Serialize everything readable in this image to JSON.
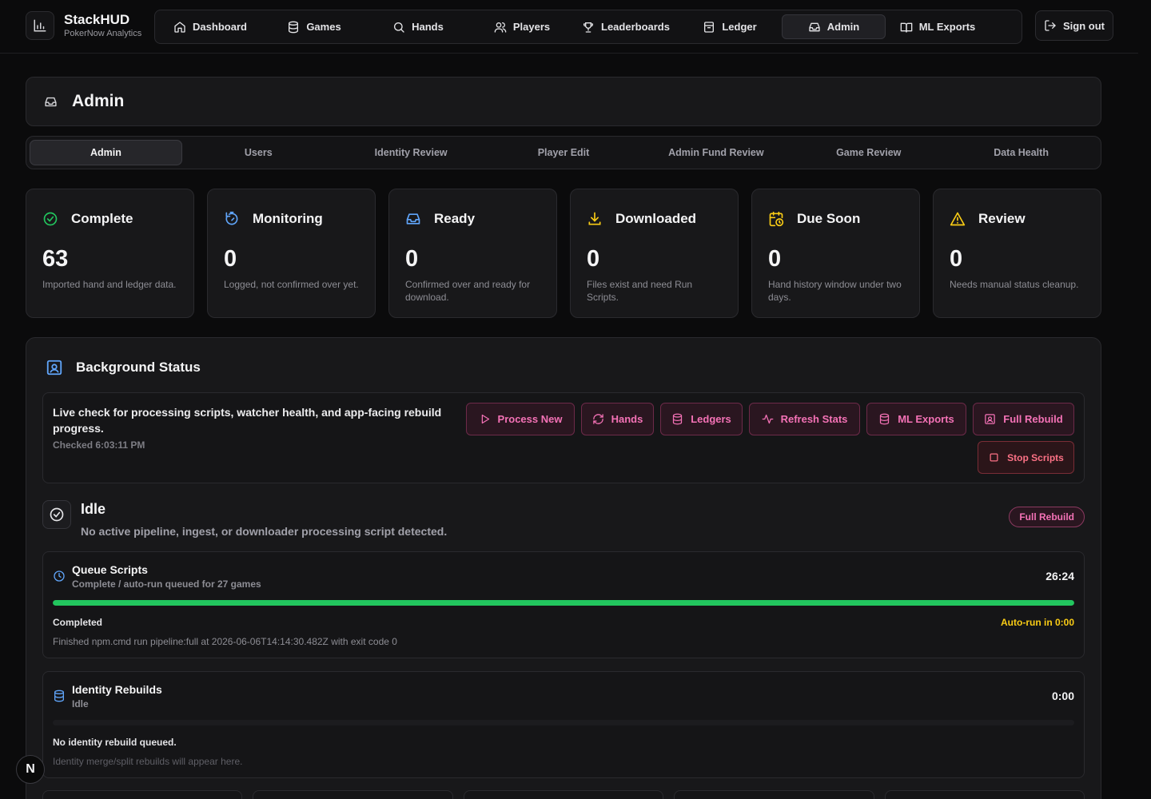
{
  "brand": {
    "name": "StackHUD",
    "subtitle": "PokerNow Analytics",
    "logo_icon": "bar-chart-icon"
  },
  "nav": [
    {
      "label": "Dashboard",
      "icon": "home-icon",
      "active": false
    },
    {
      "label": "Games",
      "icon": "database-icon",
      "active": false
    },
    {
      "label": "Hands",
      "icon": "search-icon",
      "active": false
    },
    {
      "label": "Players",
      "icon": "users-icon",
      "active": false
    },
    {
      "label": "Leaderboards",
      "icon": "trophy-icon",
      "active": false
    },
    {
      "label": "Ledger",
      "icon": "ledger-icon",
      "active": false
    },
    {
      "label": "Admin",
      "icon": "inbox-icon",
      "active": true
    },
    {
      "label": "ML Exports",
      "icon": "book-icon",
      "active": false
    }
  ],
  "signout_label": "Sign out",
  "page": {
    "title": "Admin",
    "title_icon": "inbox-icon"
  },
  "tabs": [
    {
      "label": "Admin",
      "active": true
    },
    {
      "label": "Users",
      "active": false
    },
    {
      "label": "Identity Review",
      "active": false
    },
    {
      "label": "Player Edit",
      "active": false
    },
    {
      "label": "Admin Fund Review",
      "active": false
    },
    {
      "label": "Game Review",
      "active": false
    },
    {
      "label": "Data Health",
      "active": false
    }
  ],
  "stats": [
    {
      "title": "Complete",
      "value": "63",
      "desc": "Imported hand and ledger data.",
      "icon": "check-circle-icon",
      "color": "#22c55e"
    },
    {
      "title": "Monitoring",
      "value": "0",
      "desc": "Logged, not confirmed over yet.",
      "icon": "timer-icon",
      "color": "#60a5fa"
    },
    {
      "title": "Ready",
      "value": "0",
      "desc": "Confirmed over and ready for download.",
      "icon": "inbox-icon",
      "color": "#60a5fa"
    },
    {
      "title": "Downloaded",
      "value": "0",
      "desc": "Files exist and need Run Scripts.",
      "icon": "download-icon",
      "color": "#facc15"
    },
    {
      "title": "Due Soon",
      "value": "0",
      "desc": "Hand history window under two days.",
      "icon": "calendar-clock-icon",
      "color": "#facc15"
    },
    {
      "title": "Review",
      "value": "0",
      "desc": "Needs manual status cleanup.",
      "icon": "alert-triangle-icon",
      "color": "#facc15"
    }
  ],
  "background": {
    "title": "Background Status",
    "icon": "scan-icon",
    "live_text": "Live check for processing scripts, watcher health, and app-facing rebuild progress.",
    "checked": "Checked 6:03:11 PM",
    "actions": [
      {
        "label": "Process New",
        "icon": "play-icon"
      },
      {
        "label": "Hands",
        "icon": "refresh-icon"
      },
      {
        "label": "Ledgers",
        "icon": "database-icon"
      },
      {
        "label": "Refresh Stats",
        "icon": "activity-icon"
      },
      {
        "label": "ML Exports",
        "icon": "database-icon"
      },
      {
        "label": "Full Rebuild",
        "icon": "scan-icon"
      }
    ],
    "stop_label": "Stop Scripts",
    "idle_title": "Idle",
    "idle_desc": "No active pipeline, ingest, or downloader processing script detected.",
    "badge": "Full Rebuild",
    "queue": {
      "title": "Queue Scripts",
      "subtitle": "Complete / auto-run queued for 27 games",
      "time": "26:24",
      "progress": 1.0,
      "status": "Completed",
      "auto": "Auto-run in 0:00",
      "note": "Finished npm.cmd run pipeline:full at 2026-06-06T14:14:30.482Z with exit code 0"
    },
    "identity": {
      "title": "Identity Rebuilds",
      "subtitle": "Idle",
      "time": "0:00",
      "progress": 0,
      "status": "No identity rebuild queued.",
      "note": "Identity merge/split rebuilds will appear here."
    }
  },
  "fab_label": "N"
}
